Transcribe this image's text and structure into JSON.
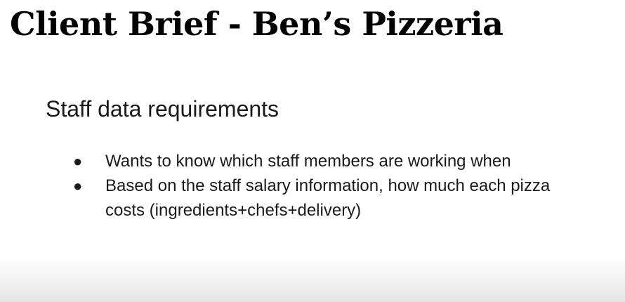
{
  "slide": {
    "title": "Client Brief - Ben’s Pizzeria",
    "subtitle": "Staff data requirements",
    "bullets": [
      {
        "marker": "●",
        "text": "Wants to know which staff members are working when"
      },
      {
        "marker": "●",
        "text": "Based on the staff salary information, how much each pizza costs (ingredients+chefs+delivery)"
      }
    ]
  }
}
